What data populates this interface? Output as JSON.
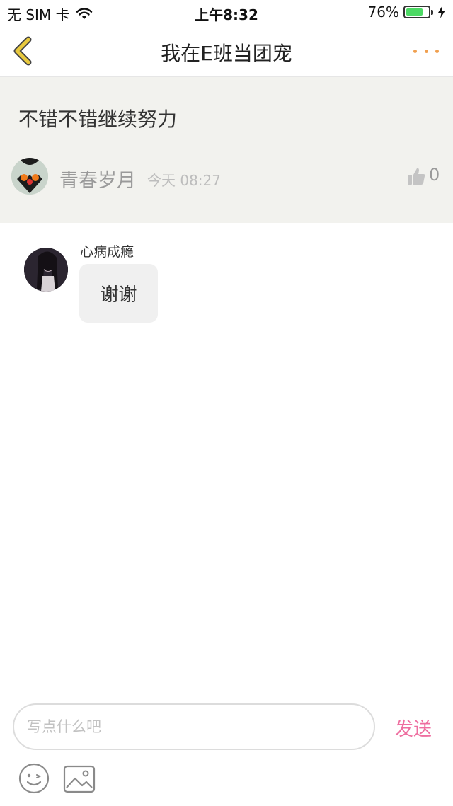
{
  "status_bar": {
    "carrier": "无 SIM 卡",
    "time": "上午8:32",
    "battery": "76%",
    "battery_level": 0.76,
    "icons": [
      "wifi-icon",
      "battery-icon",
      "charging-bolt-icon"
    ]
  },
  "nav": {
    "title": "我在E班当团宠",
    "back_icon": "chevron-left-icon",
    "more_icon": "more-dots-icon",
    "accent_back": "#e8c93e",
    "accent_more": "#f0a050"
  },
  "post": {
    "text": "不错不错继续努力",
    "author": "青春岁月",
    "time": "今天 08:27",
    "like_count": "0",
    "like_icon": "thumbs-up-icon",
    "background": "#f2f2ee"
  },
  "reply": {
    "author": "心病成瘾",
    "text": "谢谢"
  },
  "compose": {
    "placeholder": "写点什么吧",
    "value": "",
    "send_label": "发送",
    "send_color": "#ee6fa0",
    "emoji_icon": "emoji-icon",
    "image_icon": "image-icon"
  }
}
